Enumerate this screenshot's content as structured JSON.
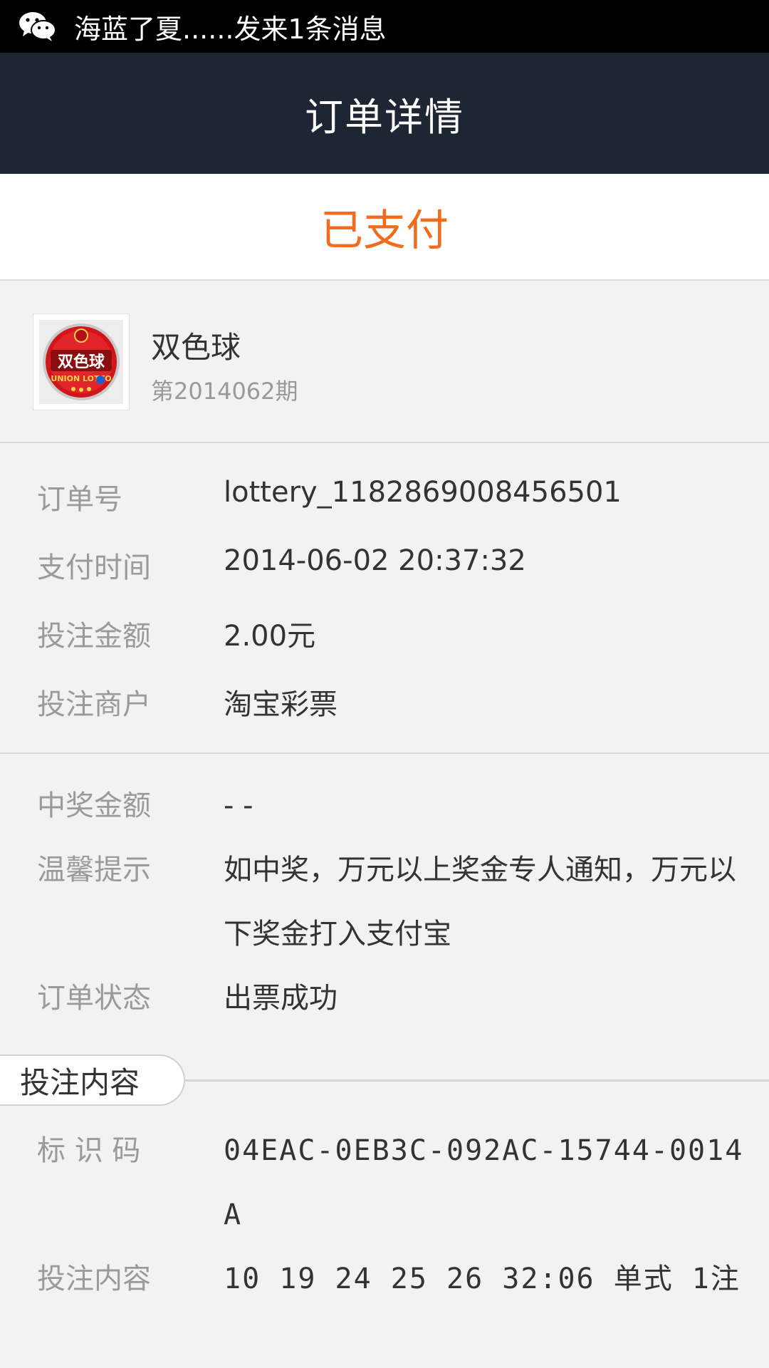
{
  "status_bar": {
    "icon": "wechat-icon",
    "notification": "海蓝了夏......发来1条消息"
  },
  "header": {
    "title": "订单详情"
  },
  "payment": {
    "status": "已支付",
    "color": "#f36b1c"
  },
  "product": {
    "icon": "shuangseqiu-logo",
    "name": "双色球",
    "period": "第2014062期",
    "logo_text": "双色球",
    "logo_subtext": "UNION LOTTO"
  },
  "order_info": [
    {
      "label": "订单号",
      "value": "lottery_1182869008456501"
    },
    {
      "label": "支付时间",
      "value": "2014-06-02  20:37:32"
    },
    {
      "label": "投注金额",
      "value": "2.00元"
    },
    {
      "label": "投注商户",
      "value": "淘宝彩票"
    }
  ],
  "prize_info": {
    "prize_label": "中奖金额",
    "prize_value": "- -",
    "tip_label": "温馨提示",
    "tip_value": "如中奖，万元以上奖金专人通知，万元以下奖金打入支付宝",
    "state_label": "订单状态",
    "state_value": "出票成功"
  },
  "bet_section": {
    "title": "投注内容",
    "id_label": "标 识 码",
    "id_value": "04EAC-0EB3C-092AC-15744-0014A",
    "content_label": "投注内容",
    "content_value": "10 19 24 25 26 32:06 单式 1注"
  }
}
